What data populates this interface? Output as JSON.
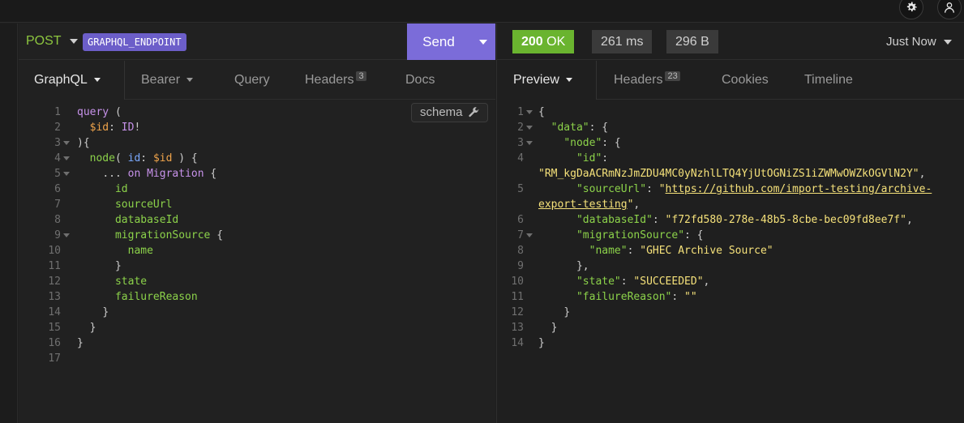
{
  "request": {
    "method": "POST",
    "endpoint": "GRAPHQL_ENDPOINT",
    "send_label": "Send",
    "tabs": [
      {
        "label": "GraphQL"
      },
      {
        "label": "Bearer"
      },
      {
        "label": "Query"
      },
      {
        "label": "Headers",
        "count": "3"
      },
      {
        "label": "Docs"
      }
    ],
    "schema_label": "schema",
    "lines": [
      "1",
      "2",
      "3",
      "4",
      "5",
      "6",
      "7",
      "8",
      "9",
      "10",
      "11",
      "12",
      "13",
      "14",
      "15",
      "16",
      "17"
    ]
  },
  "response": {
    "status": {
      "code": "200",
      "text": "OK"
    },
    "time": "261 ms",
    "size": "296 B",
    "history": "Just Now",
    "tabs": [
      {
        "label": "Preview"
      },
      {
        "label": "Headers",
        "count": "23"
      },
      {
        "label": "Cookies"
      },
      {
        "label": "Timeline"
      }
    ],
    "values": {
      "id": "\"RM_kgDaACRmNzJmZDU4MC0yNzhlLTQ4YjUtOGNiZS1iZWMwOWZkOGVlN2Y\"",
      "sourceUrl_part1": "https://github.com/import-testing/archive-",
      "sourceUrl_part2": "export-testing",
      "databaseId": "\"f72fd580-278e-48b5-8cbe-bec09fd8ee7f\"",
      "name": "\"GHEC Archive Source\"",
      "state": "\"SUCCEEDED\"",
      "failureReason": "\"\""
    },
    "lines": [
      "1",
      "2",
      "3",
      "4",
      "5",
      "6",
      "7",
      "8",
      "9",
      "10",
      "11",
      "12",
      "13",
      "14"
    ]
  },
  "colors": {
    "accent": "#7b6cd9",
    "success": "#6ab42f",
    "endpoint_tag": "#6c5ec9"
  }
}
